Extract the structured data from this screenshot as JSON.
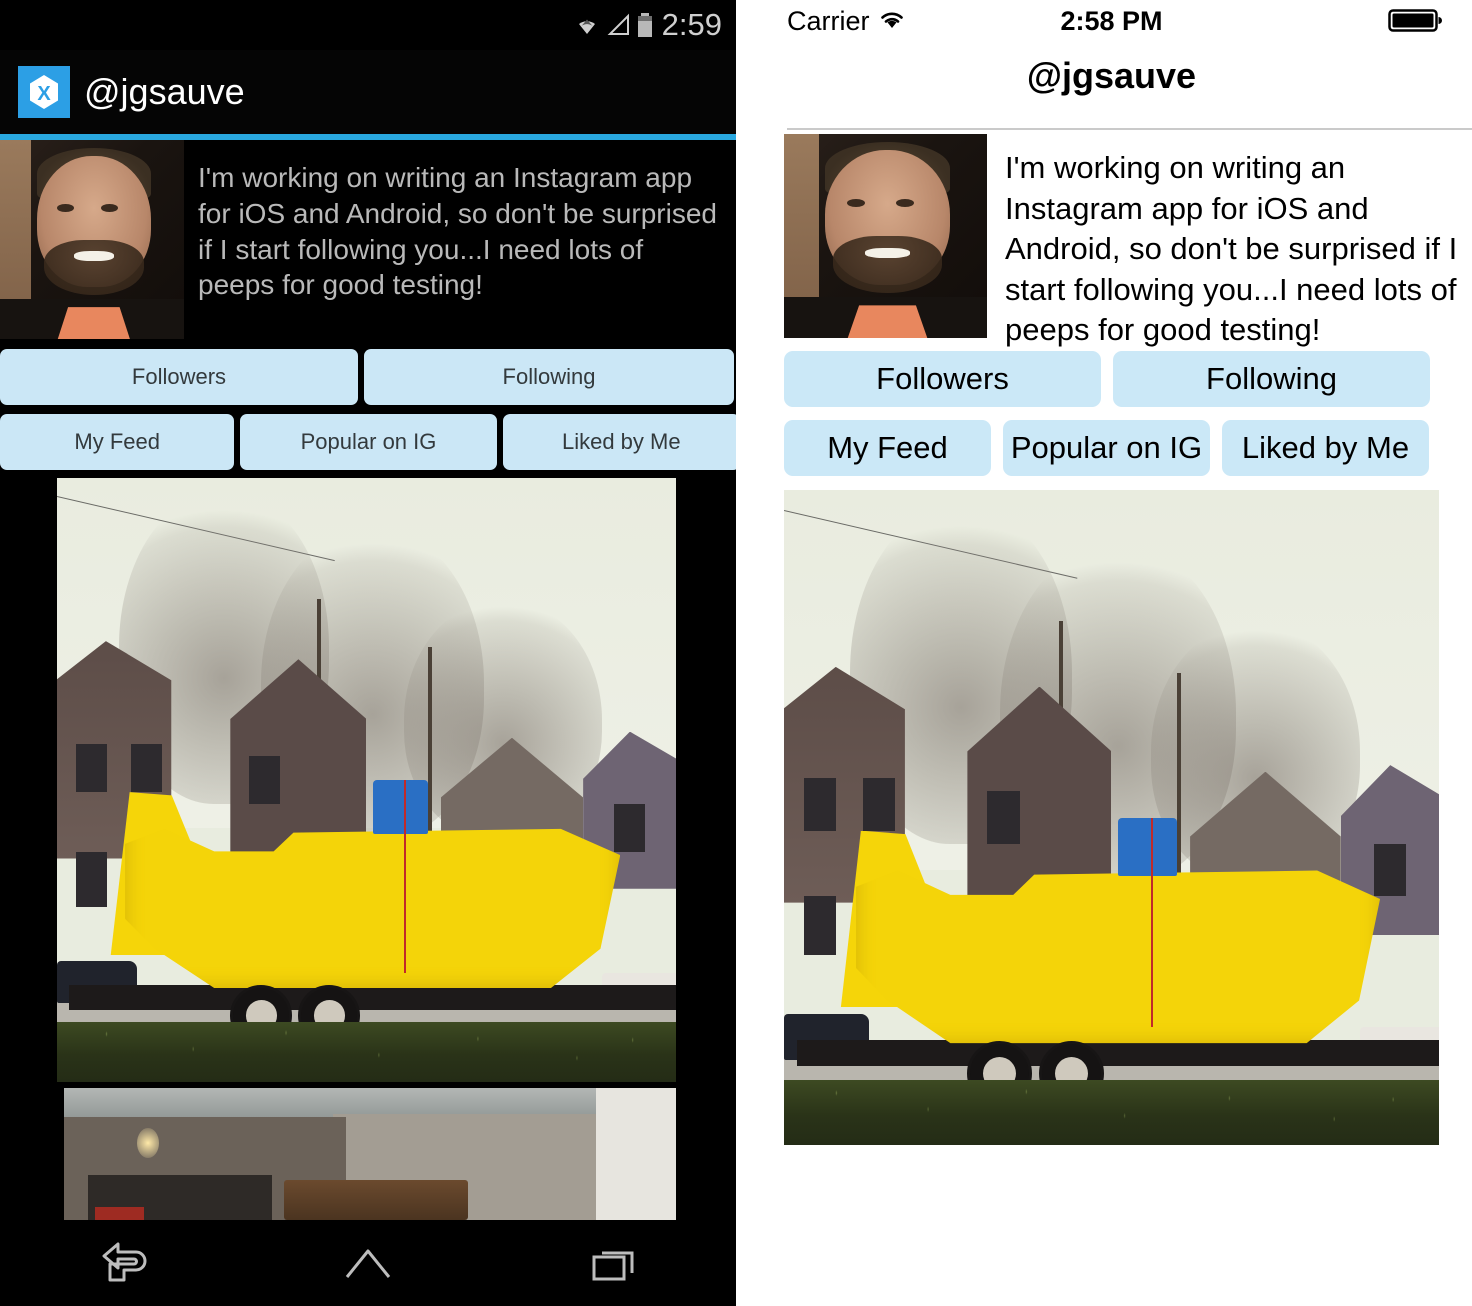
{
  "android": {
    "status_bar": {
      "time": "2:59",
      "icons": [
        "wifi-icon",
        "cell-signal-icon",
        "battery-icon"
      ]
    },
    "action_bar": {
      "logo": "xamarin-logo-icon",
      "title": "@jgsauve"
    },
    "profile": {
      "avatar": "profile-avatar-photo",
      "bio": "I'm working on writing an Instagram app for iOS and Android, so don't be surprised if I start following you...I need lots of peeps for good testing!"
    },
    "buttons_row1": [
      {
        "label": "Followers",
        "name": "followers-button"
      },
      {
        "label": "Following",
        "name": "following-button"
      }
    ],
    "buttons_row2": [
      {
        "label": "My Feed",
        "name": "my-feed-button"
      },
      {
        "label": "Popular on IG",
        "name": "popular-on-ig-button"
      },
      {
        "label": "Liked by Me",
        "name": "liked-by-me-button"
      }
    ],
    "feed": [
      {
        "name": "feed-photo-yellow-boat",
        "alt": "Yellow amphibious boat on a trailer parked in front of houses"
      },
      {
        "name": "feed-photo-garage",
        "alt": "Interior of a garage with firewood and a hanging light bulb"
      }
    ],
    "nav_bar": {
      "items": [
        "back-icon",
        "home-icon",
        "recents-icon"
      ]
    },
    "colors": {
      "accent_line": "#29a8e0",
      "logo_blue": "#2c9fe5",
      "button_fill": "#cbe7f6",
      "background": "#000000",
      "bio_text": "#b9b9b9"
    }
  },
  "ios": {
    "status_bar": {
      "carrier": "Carrier",
      "time": "2:58 PM",
      "icons": [
        "wifi-icon",
        "battery-icon"
      ]
    },
    "nav_bar": {
      "title": "@jgsauve"
    },
    "profile": {
      "avatar": "profile-avatar-photo",
      "bio": "I'm working on writing an Instagram app for iOS and Android, so don't be surprised if I start following you...I need lots of peeps for good testing!"
    },
    "buttons_row1": [
      {
        "label": "Followers",
        "name": "followers-button"
      },
      {
        "label": "Following",
        "name": "following-button"
      }
    ],
    "buttons_row2": [
      {
        "label": "My Feed",
        "name": "my-feed-button"
      },
      {
        "label": "Popular on IG",
        "name": "popular-on-ig-button"
      },
      {
        "label": "Liked by Me",
        "name": "liked-by-me-button"
      }
    ],
    "feed": [
      {
        "name": "feed-photo-yellow-boat",
        "alt": "Yellow amphibious boat on a trailer parked in front of houses"
      }
    ],
    "colors": {
      "button_fill": "#cbe8f7",
      "background": "#ffffff",
      "separator": "#cacaca",
      "text": "#000000"
    }
  }
}
